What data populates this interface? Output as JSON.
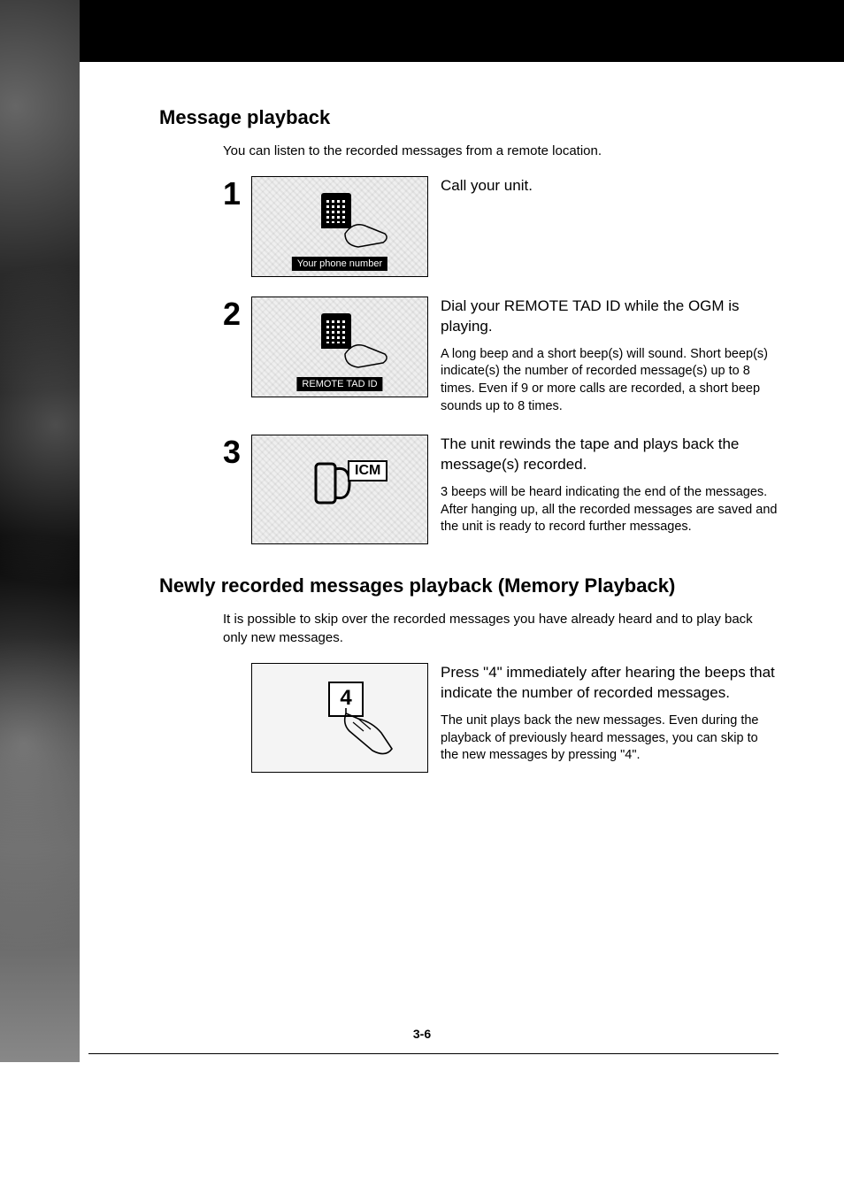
{
  "section1": {
    "heading": "Message playback",
    "intro": "You can listen to the recorded messages from a remote location.",
    "steps": [
      {
        "num": "1",
        "caption": "Your phone number",
        "lead": "Call your unit.",
        "detail": ""
      },
      {
        "num": "2",
        "caption": "REMOTE TAD ID",
        "lead": "Dial your REMOTE TAD ID while the OGM is playing.",
        "detail": "A long beep and a short beep(s) will sound. Short beep(s) indicate(s) the number of recorded message(s) up to 8 times. Even if 9 or more calls are recorded, a short beep sounds up to 8 times."
      },
      {
        "num": "3",
        "icm": "ICM",
        "lead": "The unit rewinds the tape and plays back the message(s) recorded.",
        "detail": "3 beeps will be heard indicating the end of the messages. After hanging up, all the recorded messages are saved and the unit is ready to record further messages."
      }
    ]
  },
  "section2": {
    "heading": "Newly recorded messages playback (Memory Playback)",
    "intro": "It is possible to skip over the recorded messages you have already heard and to play back only new messages.",
    "key": "4",
    "lead": "Press \"4\" immediately after hearing the beeps that indicate the number of recorded messages.",
    "detail": "The unit plays back the new messages. Even during the playback of previously heard messages, you can skip to the new messages by pressing \"4\"."
  },
  "page_number": "3-6"
}
